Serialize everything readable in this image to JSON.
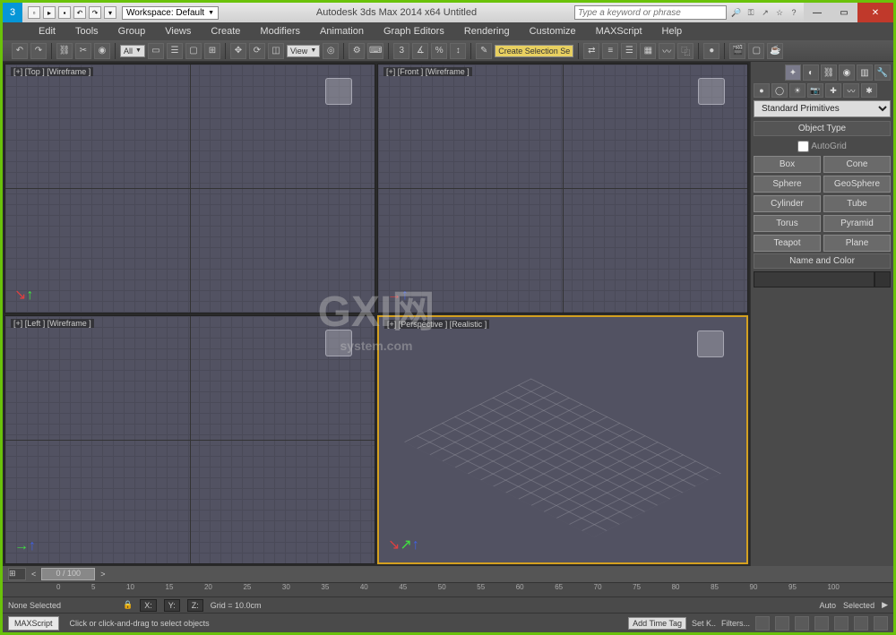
{
  "titlebar": {
    "workspace": "Workspace: Default",
    "app_title": "Autodesk 3ds Max  2014 x64        Untitled",
    "search_placeholder": "Type a keyword or phrase"
  },
  "menu": [
    "Edit",
    "Tools",
    "Group",
    "Views",
    "Create",
    "Modifiers",
    "Animation",
    "Graph Editors",
    "Rendering",
    "Customize",
    "MAXScript",
    "Help"
  ],
  "toolbar": {
    "all_dd": "All",
    "view_dd": "View",
    "sel_dd": "Create Selection Se"
  },
  "viewports": {
    "top": "[+] [Top ] [Wireframe ]",
    "front": "[+] [Front ] [Wireframe ]",
    "left": "[+] [Left ] [Wireframe ]",
    "persp": "[+] [Perspective ] [Realistic ]"
  },
  "watermark": {
    "main": "GXI网",
    "sub": "system.com"
  },
  "panel": {
    "category": "Standard Primitives",
    "rollout_objtype": "Object Type",
    "autogrid": "AutoGrid",
    "buttons": [
      "Box",
      "Cone",
      "Sphere",
      "GeoSphere",
      "Cylinder",
      "Tube",
      "Torus",
      "Pyramid",
      "Teapot",
      "Plane"
    ],
    "rollout_namecolor": "Name and Color"
  },
  "time": {
    "slider": "0 / 100",
    "ticks": [
      "0",
      "5",
      "10",
      "15",
      "20",
      "25",
      "30",
      "35",
      "40",
      "45",
      "50",
      "55",
      "60",
      "65",
      "70",
      "75",
      "80",
      "85",
      "90",
      "95",
      "100"
    ]
  },
  "status": {
    "selection": "None Selected",
    "x": "X:",
    "y": "Y:",
    "z": "Z:",
    "grid": "Grid = 10.0cm",
    "auto": "Auto",
    "setk": "Set K..",
    "selected": "Selected",
    "filters": "Filters..."
  },
  "status2": {
    "ms": "MAXScript",
    "hint": "Click or click-and-drag to select objects",
    "addtag": "Add Time Tag"
  }
}
